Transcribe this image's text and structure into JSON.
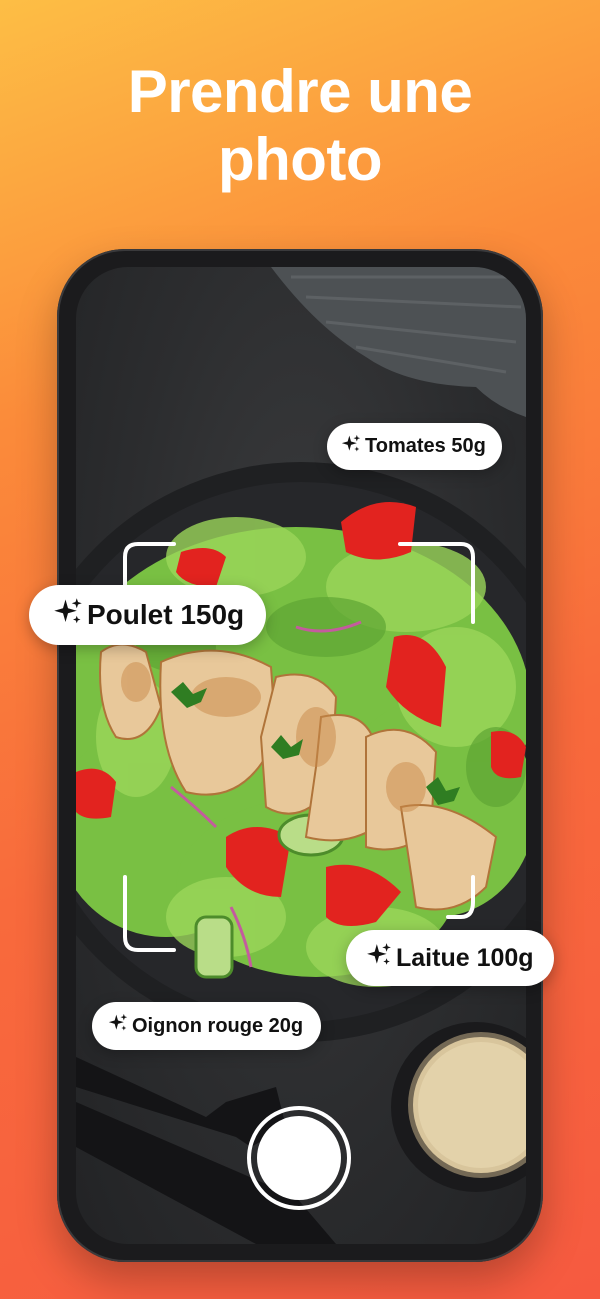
{
  "headline": {
    "line1": "Prendre une",
    "line2": "photo"
  },
  "labels": {
    "tomates": "Tomates 50g",
    "poulet": "Poulet 150g",
    "laitue": "Laitue 100g",
    "oignon": "Oignon rouge 20g"
  },
  "icons": {
    "tag_icon": "sparkles-icon",
    "shutter": "shutter-button"
  },
  "colors": {
    "gradient_top": "#fdbe45",
    "gradient_bottom": "#f65a40",
    "tag_background": "#ffffff",
    "tag_text": "#111111"
  }
}
